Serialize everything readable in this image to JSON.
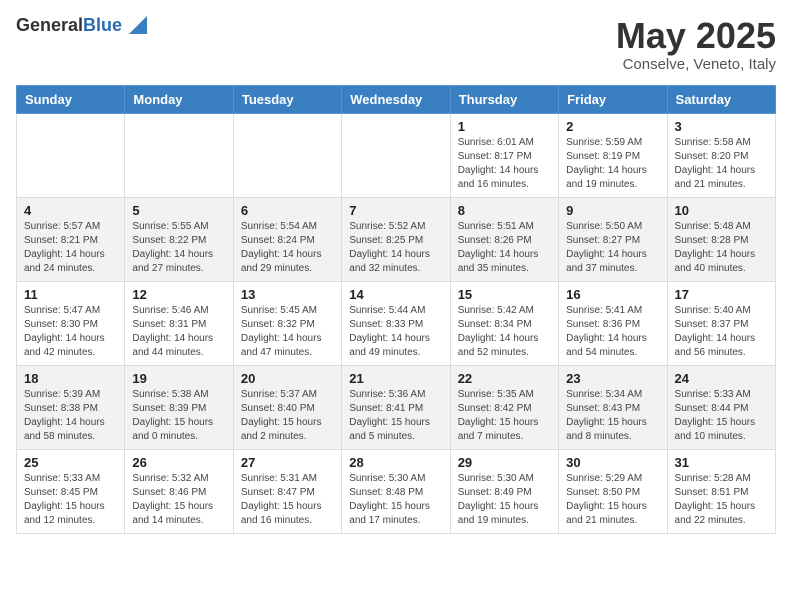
{
  "header": {
    "logo": {
      "general": "General",
      "blue": "Blue"
    },
    "title": "May 2025",
    "location": "Conselve, Veneto, Italy"
  },
  "days_of_week": [
    "Sunday",
    "Monday",
    "Tuesday",
    "Wednesday",
    "Thursday",
    "Friday",
    "Saturday"
  ],
  "weeks": [
    [
      null,
      null,
      null,
      null,
      {
        "day": 1,
        "sunrise": "6:01 AM",
        "sunset": "8:17 PM",
        "daylight": "14 hours and 16 minutes."
      },
      {
        "day": 2,
        "sunrise": "5:59 AM",
        "sunset": "8:19 PM",
        "daylight": "14 hours and 19 minutes."
      },
      {
        "day": 3,
        "sunrise": "5:58 AM",
        "sunset": "8:20 PM",
        "daylight": "14 hours and 21 minutes."
      }
    ],
    [
      {
        "day": 4,
        "sunrise": "5:57 AM",
        "sunset": "8:21 PM",
        "daylight": "14 hours and 24 minutes."
      },
      {
        "day": 5,
        "sunrise": "5:55 AM",
        "sunset": "8:22 PM",
        "daylight": "14 hours and 27 minutes."
      },
      {
        "day": 6,
        "sunrise": "5:54 AM",
        "sunset": "8:24 PM",
        "daylight": "14 hours and 29 minutes."
      },
      {
        "day": 7,
        "sunrise": "5:52 AM",
        "sunset": "8:25 PM",
        "daylight": "14 hours and 32 minutes."
      },
      {
        "day": 8,
        "sunrise": "5:51 AM",
        "sunset": "8:26 PM",
        "daylight": "14 hours and 35 minutes."
      },
      {
        "day": 9,
        "sunrise": "5:50 AM",
        "sunset": "8:27 PM",
        "daylight": "14 hours and 37 minutes."
      },
      {
        "day": 10,
        "sunrise": "5:48 AM",
        "sunset": "8:28 PM",
        "daylight": "14 hours and 40 minutes."
      }
    ],
    [
      {
        "day": 11,
        "sunrise": "5:47 AM",
        "sunset": "8:30 PM",
        "daylight": "14 hours and 42 minutes."
      },
      {
        "day": 12,
        "sunrise": "5:46 AM",
        "sunset": "8:31 PM",
        "daylight": "14 hours and 44 minutes."
      },
      {
        "day": 13,
        "sunrise": "5:45 AM",
        "sunset": "8:32 PM",
        "daylight": "14 hours and 47 minutes."
      },
      {
        "day": 14,
        "sunrise": "5:44 AM",
        "sunset": "8:33 PM",
        "daylight": "14 hours and 49 minutes."
      },
      {
        "day": 15,
        "sunrise": "5:42 AM",
        "sunset": "8:34 PM",
        "daylight": "14 hours and 52 minutes."
      },
      {
        "day": 16,
        "sunrise": "5:41 AM",
        "sunset": "8:36 PM",
        "daylight": "14 hours and 54 minutes."
      },
      {
        "day": 17,
        "sunrise": "5:40 AM",
        "sunset": "8:37 PM",
        "daylight": "14 hours and 56 minutes."
      }
    ],
    [
      {
        "day": 18,
        "sunrise": "5:39 AM",
        "sunset": "8:38 PM",
        "daylight": "14 hours and 58 minutes."
      },
      {
        "day": 19,
        "sunrise": "5:38 AM",
        "sunset": "8:39 PM",
        "daylight": "15 hours and 0 minutes."
      },
      {
        "day": 20,
        "sunrise": "5:37 AM",
        "sunset": "8:40 PM",
        "daylight": "15 hours and 2 minutes."
      },
      {
        "day": 21,
        "sunrise": "5:36 AM",
        "sunset": "8:41 PM",
        "daylight": "15 hours and 5 minutes."
      },
      {
        "day": 22,
        "sunrise": "5:35 AM",
        "sunset": "8:42 PM",
        "daylight": "15 hours and 7 minutes."
      },
      {
        "day": 23,
        "sunrise": "5:34 AM",
        "sunset": "8:43 PM",
        "daylight": "15 hours and 8 minutes."
      },
      {
        "day": 24,
        "sunrise": "5:33 AM",
        "sunset": "8:44 PM",
        "daylight": "15 hours and 10 minutes."
      }
    ],
    [
      {
        "day": 25,
        "sunrise": "5:33 AM",
        "sunset": "8:45 PM",
        "daylight": "15 hours and 12 minutes."
      },
      {
        "day": 26,
        "sunrise": "5:32 AM",
        "sunset": "8:46 PM",
        "daylight": "15 hours and 14 minutes."
      },
      {
        "day": 27,
        "sunrise": "5:31 AM",
        "sunset": "8:47 PM",
        "daylight": "15 hours and 16 minutes."
      },
      {
        "day": 28,
        "sunrise": "5:30 AM",
        "sunset": "8:48 PM",
        "daylight": "15 hours and 17 minutes."
      },
      {
        "day": 29,
        "sunrise": "5:30 AM",
        "sunset": "8:49 PM",
        "daylight": "15 hours and 19 minutes."
      },
      {
        "day": 30,
        "sunrise": "5:29 AM",
        "sunset": "8:50 PM",
        "daylight": "15 hours and 21 minutes."
      },
      {
        "day": 31,
        "sunrise": "5:28 AM",
        "sunset": "8:51 PM",
        "daylight": "15 hours and 22 minutes."
      }
    ]
  ],
  "labels": {
    "sunrise": "Sunrise:",
    "sunset": "Sunset:",
    "daylight": "Daylight:"
  }
}
